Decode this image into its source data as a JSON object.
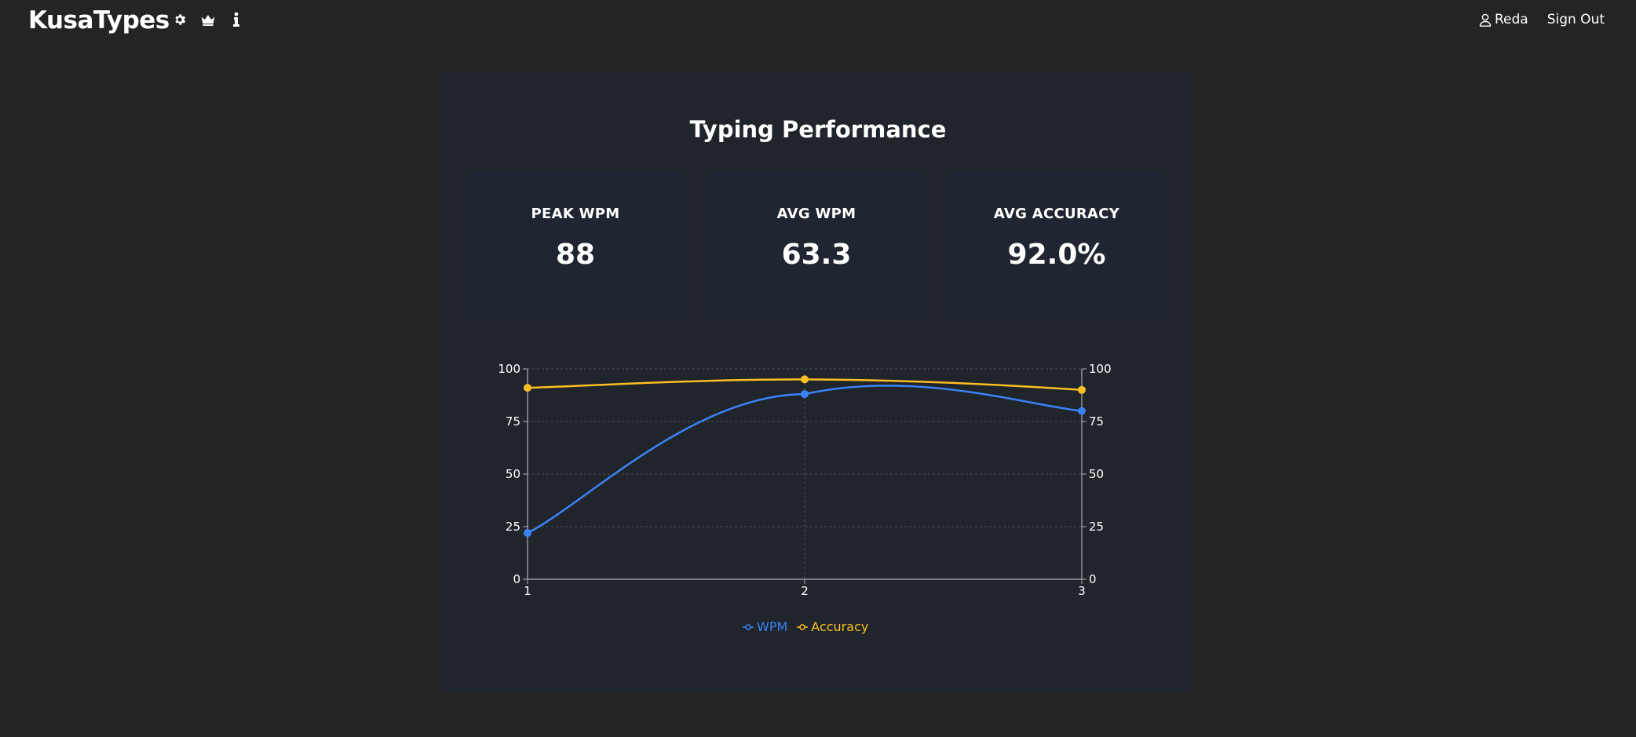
{
  "app": {
    "title": "KusaTypes",
    "nav_icons": [
      "gear-icon",
      "crown-icon",
      "info-icon"
    ]
  },
  "user": {
    "name": "Reda",
    "sign_out_label": "Sign Out",
    "icon": "user-icon"
  },
  "card": {
    "title": "Typing Performance"
  },
  "stats": [
    {
      "label": "PEAK WPM",
      "value": "88"
    },
    {
      "label": "AVG WPM",
      "value": "63.3"
    },
    {
      "label": "AVG ACCURACY",
      "value": "92.0%"
    }
  ],
  "colors": {
    "background": "#242424",
    "card": "#20242b",
    "stat_card": "#1f2631",
    "wpm": "#3b82f6",
    "accuracy": "#fbbf24",
    "axis": "#b0b0b0",
    "grid": "#4a4f58"
  },
  "chart_data": {
    "type": "line",
    "x": [
      1,
      2,
      3
    ],
    "xticks": [
      "1",
      "2",
      "3"
    ],
    "ylim": [
      0,
      100
    ],
    "yticks": [
      "0",
      "25",
      "50",
      "75",
      "100"
    ],
    "y2lim": [
      0,
      100
    ],
    "y2ticks": [
      "0",
      "25",
      "50",
      "75",
      "100"
    ],
    "grid": true,
    "legend_position": "bottom-center",
    "series": [
      {
        "name": "WPM",
        "values": [
          22,
          88,
          80
        ],
        "color": "#3b82f6",
        "axis": "left"
      },
      {
        "name": "Accuracy",
        "values": [
          91,
          95,
          90
        ],
        "color": "#fbbf24",
        "axis": "right"
      }
    ]
  }
}
